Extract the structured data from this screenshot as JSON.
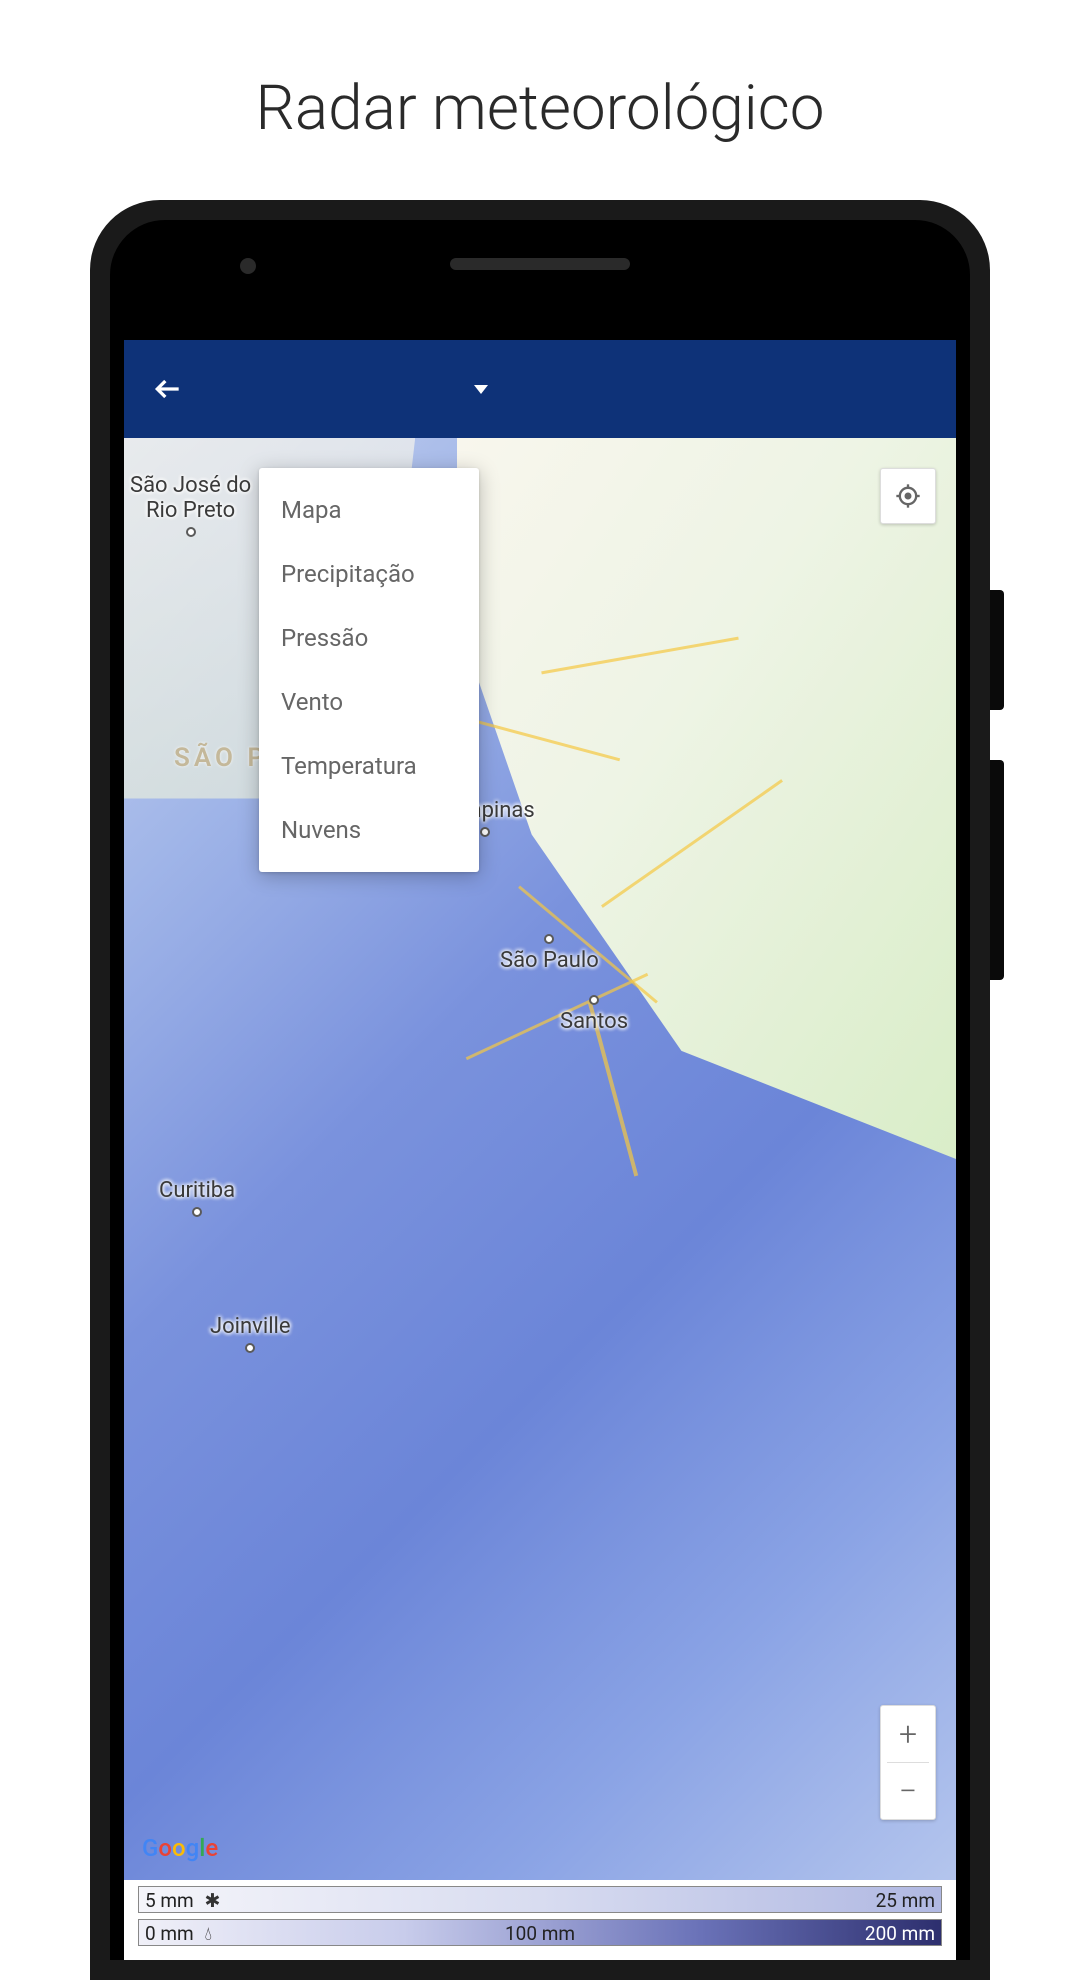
{
  "page": {
    "title": "Radar meteorológico"
  },
  "header": {
    "dropdown_selected": "Mapa"
  },
  "dropdown": {
    "items": [
      {
        "label": "Mapa"
      },
      {
        "label": "Precipitação"
      },
      {
        "label": "Pressão"
      },
      {
        "label": "Vento"
      },
      {
        "label": "Temperatura"
      },
      {
        "label": "Nuvens"
      }
    ]
  },
  "map": {
    "state_label": "SÃO PA",
    "cities": [
      {
        "name": "São José do\nRio Preto"
      },
      {
        "name": "Campinas"
      },
      {
        "name": "São Paulo"
      },
      {
        "name": "Santos"
      },
      {
        "name": "Curitiba"
      },
      {
        "name": "Joinville"
      }
    ],
    "attribution": "Google"
  },
  "legend": {
    "bar1": {
      "left": "5 mm",
      "right": "25 mm",
      "icon": "snowflake"
    },
    "bar2": {
      "left": "0 mm",
      "center": "100 mm",
      "right": "200 mm",
      "icon": "droplet"
    }
  },
  "controls": {
    "zoom_in": "+",
    "zoom_out": "−"
  }
}
